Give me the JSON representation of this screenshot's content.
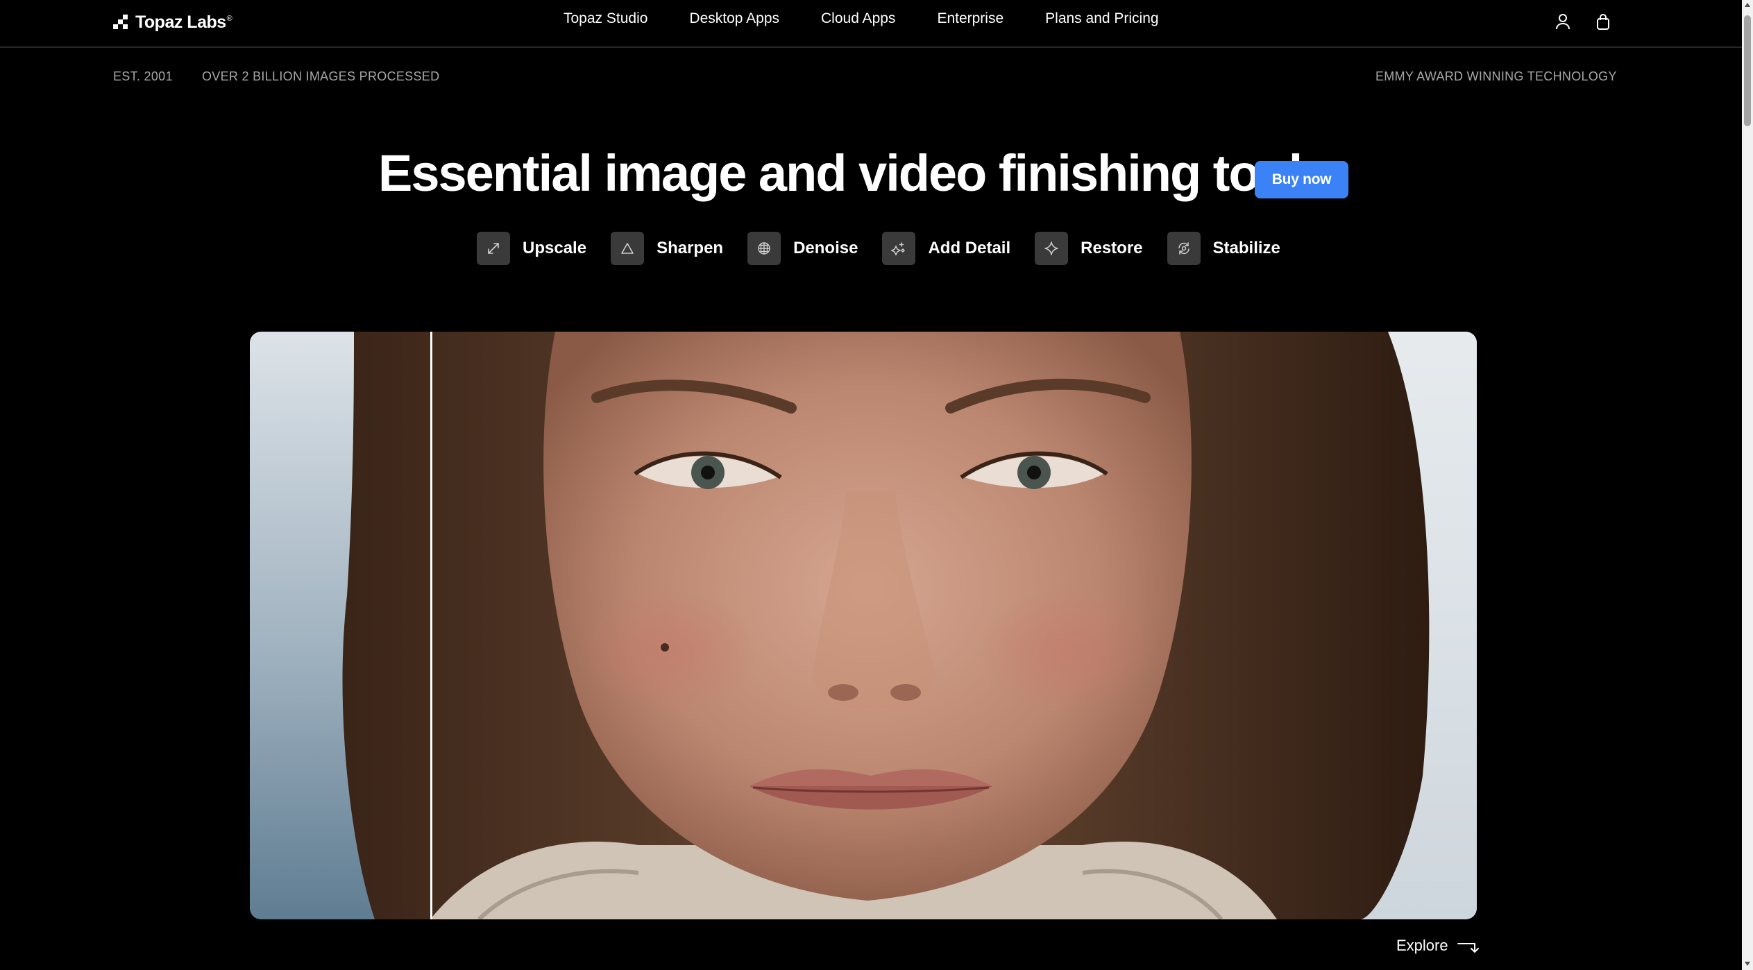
{
  "header": {
    "logo_text": "Topaz Labs",
    "logo_mark": "®",
    "nav": [
      "Topaz Studio",
      "Desktop Apps",
      "Cloud Apps",
      "Enterprise",
      "Plans and Pricing"
    ],
    "icons": [
      "user-icon",
      "shopping-bag-icon"
    ]
  },
  "stats": {
    "established": "EST. 2001",
    "images_processed": "OVER 2 BILLION IMAGES PROCESSED",
    "award": "EMMY AWARD WINNING TECHNOLOGY"
  },
  "hero": {
    "title": "Essential image and video finishing tools.",
    "cta_label": "Buy now",
    "cta_color": "#3b82f6"
  },
  "features": [
    {
      "label": "Upscale",
      "icon": "expand-arrows-icon"
    },
    {
      "label": "Sharpen",
      "icon": "triangle-icon"
    },
    {
      "label": "Denoise",
      "icon": "grain-globe-icon"
    },
    {
      "label": "Add Detail",
      "icon": "sparkle-detail-icon"
    },
    {
      "label": "Restore",
      "icon": "sparkle-star-icon"
    },
    {
      "label": "Stabilize",
      "icon": "stabilize-rotate-icon"
    }
  ],
  "comparison": {
    "image": "portrait-of-woman-face-closeup",
    "slider_icon": "before-after-divider"
  },
  "explore": {
    "label": "Explore",
    "icon": "arrow-down-right-icon"
  }
}
